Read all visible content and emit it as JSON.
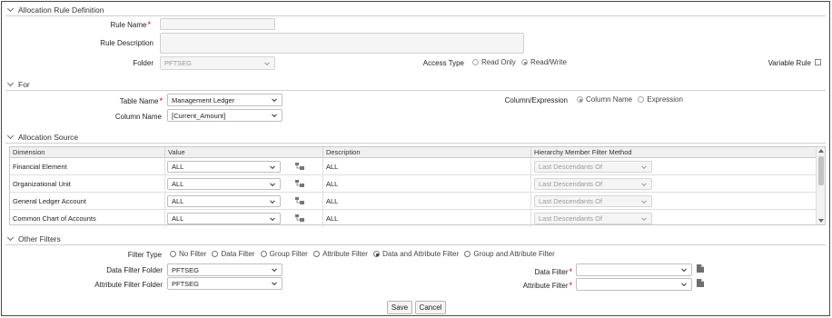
{
  "sections": {
    "rule_definition": "Allocation Rule Definition",
    "for": "For",
    "allocation_source": "Allocation Source",
    "other_filters": "Other Filters"
  },
  "rule": {
    "name_label": "Rule Name",
    "name_value": "",
    "description_label": "Rule Description",
    "description_value": "",
    "folder_label": "Folder",
    "folder_value": "PFTSEG",
    "access_type_label": "Access Type",
    "access_options": [
      "Read Only",
      "Read/Write"
    ],
    "access_selected": "Read/Write",
    "variable_rule_label": "Variable Rule",
    "variable_rule_checked": false
  },
  "for": {
    "table_name_label": "Table Name",
    "table_name_value": "Management Ledger",
    "column_name_label": "Column Name",
    "column_name_value": "[Current_Amount]",
    "column_expression_label": "Column/Expression",
    "column_expression_options": [
      "Column Name",
      "Expression"
    ],
    "column_expression_selected": "Column Name"
  },
  "allocation_source": {
    "columns": [
      "Dimension",
      "Value",
      "Description",
      "Hierarchy Member Filter Method"
    ],
    "rows": [
      {
        "dimension": "Financial Element",
        "value": "ALL",
        "description": "ALL",
        "method": "Last Descendants Of"
      },
      {
        "dimension": "Organizational Unit",
        "value": "ALL",
        "description": "ALL",
        "method": "Last Descendants Of"
      },
      {
        "dimension": "General Ledger Account",
        "value": "ALL",
        "description": "ALL",
        "method": "Last Descendants Of"
      },
      {
        "dimension": "Common Chart of Accounts",
        "value": "ALL",
        "description": "ALL",
        "method": "Last Descendants Of"
      }
    ]
  },
  "other_filters": {
    "filter_type_label": "Filter Type",
    "filter_type_options": [
      "No Filter",
      "Data Filter",
      "Group Filter",
      "Attribute Filter",
      "Data and Attribute Filter",
      "Group and Attribute Filter"
    ],
    "filter_type_selected": "Data and Attribute Filter",
    "data_filter_folder_label": "Data Filter Folder",
    "data_filter_folder_value": "PFTSEG",
    "attribute_filter_folder_label": "Attribute Filter  Folder",
    "attribute_filter_folder_value": "PFTSEG",
    "data_filter_label": "Data Filter",
    "data_filter_value": "",
    "attribute_filter_label": "Attribute Filter",
    "attribute_filter_value": ""
  },
  "buttons": {
    "save": "Save",
    "cancel": "Cancel"
  },
  "colors": {
    "required": "#d00000",
    "border": "#4a4a4a"
  }
}
